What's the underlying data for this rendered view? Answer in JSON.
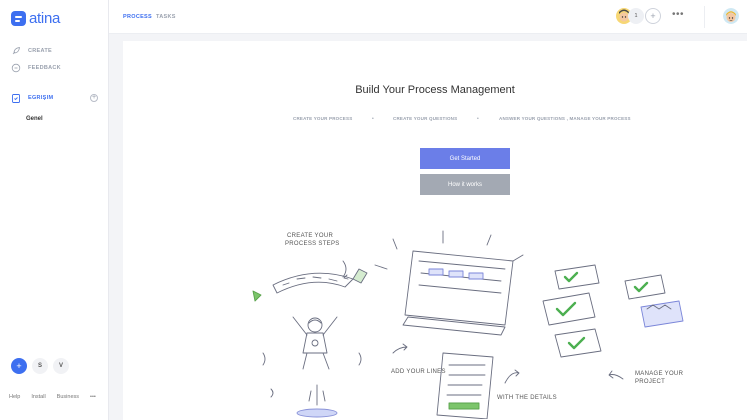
{
  "app": {
    "logo_text": "atina"
  },
  "sidebar": {
    "items": [
      {
        "label": "CREATE",
        "icon": "rocket-icon"
      },
      {
        "label": "FEEDBACK",
        "icon": "chat-icon"
      }
    ],
    "workspace": {
      "label": "EGRIŞIM",
      "icon": "clipboard-icon"
    },
    "sub_items": [
      {
        "label": "Genel"
      }
    ],
    "bottom_circles": [
      "+",
      "S",
      "V"
    ],
    "footer_links": [
      "Help",
      "Install",
      "Business",
      "•••"
    ]
  },
  "topbar": {
    "tabs": [
      {
        "label": "PROCESS",
        "active": true
      },
      {
        "label": "TASKS",
        "active": false
      }
    ],
    "member_count": "1",
    "add_label": "+",
    "more_label": "•••"
  },
  "main": {
    "title": "Build Your Process Management",
    "steps": [
      "CREATE YOUR PROCESS",
      "CREATE YOUR QUESTIONS",
      "ANSWER YOUR QUESTIONS , MANAGE YOUR PROCESS"
    ],
    "step_separator": "•",
    "primary_button": "Get Started",
    "secondary_button": "How it works",
    "illustration_labels": {
      "steps": [
        "CREATE YOUR",
        "PROCESS STEPS"
      ],
      "lines": "ADD YOUR LINES",
      "details": "WITH THE DETAILS",
      "manage": [
        "MANAGE YOUR",
        "PROJECT"
      ]
    }
  },
  "colors": {
    "accent": "#3d6ff0",
    "primary_button": "#6b7ee8",
    "secondary_button": "#a3a9b3",
    "check": "#4caf50"
  }
}
